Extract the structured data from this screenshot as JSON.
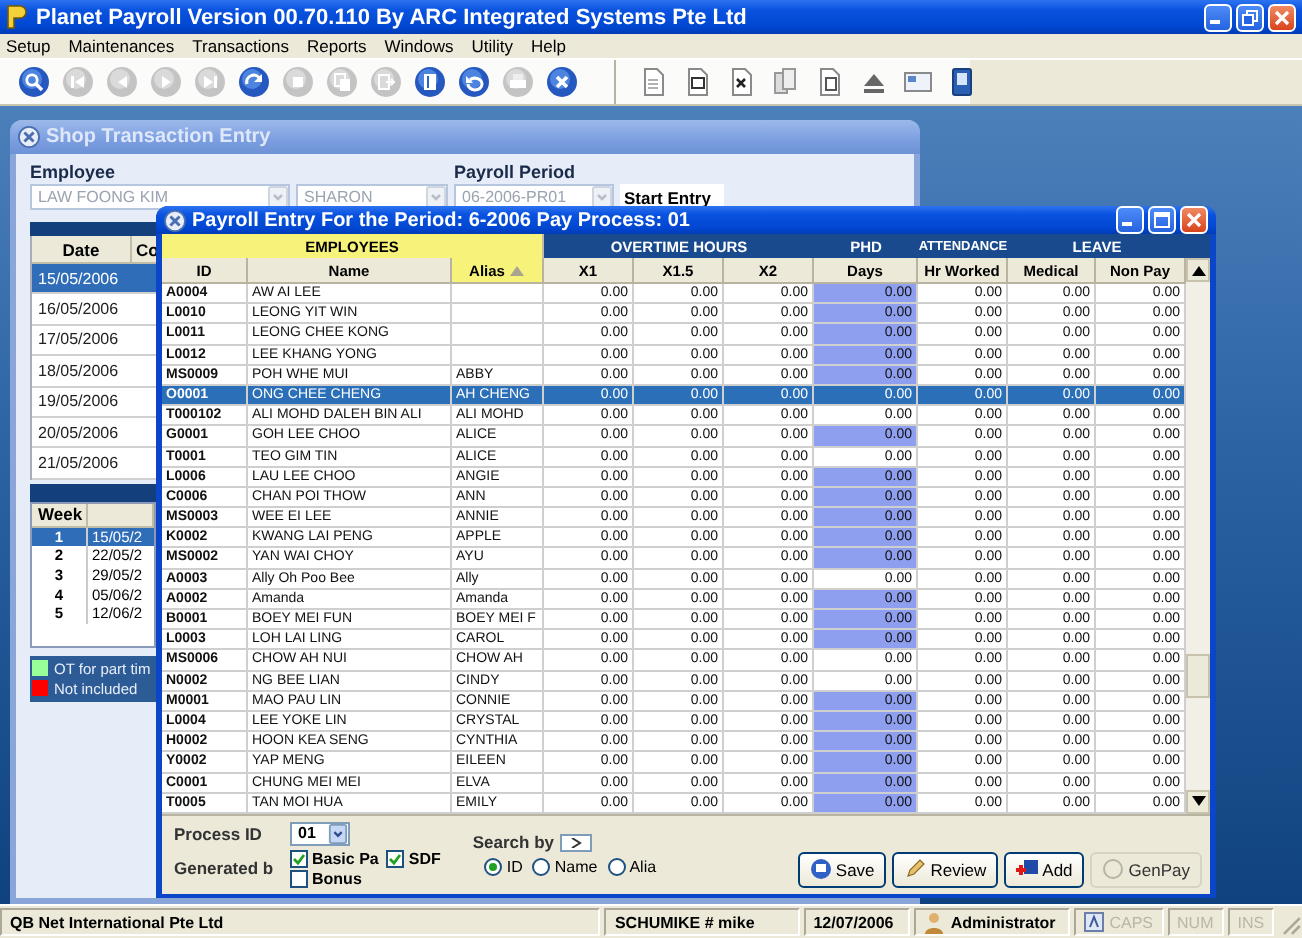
{
  "window": {
    "title": "Planet Payroll Version 00.70.110 By ARC Integrated Systems Pte Ltd"
  },
  "menu": [
    "Setup",
    "Maintenances",
    "Transactions",
    "Reports",
    "Windows",
    "Utility",
    "Help"
  ],
  "toolbar": {
    "navigation": [
      {
        "kind": "search",
        "disabled": false
      },
      {
        "kind": "first",
        "disabled": true
      },
      {
        "kind": "prev",
        "disabled": true
      },
      {
        "kind": "next",
        "disabled": true
      },
      {
        "kind": "last",
        "disabled": true
      },
      {
        "kind": "refresh",
        "disabled": false
      },
      {
        "kind": "stop",
        "disabled": true
      },
      {
        "kind": "copy",
        "disabled": true
      },
      {
        "kind": "export",
        "disabled": true
      },
      {
        "kind": "book",
        "disabled": false
      },
      {
        "kind": "undo",
        "disabled": false
      },
      {
        "kind": "print",
        "disabled": true
      },
      {
        "kind": "close",
        "disabled": false
      }
    ],
    "documents": [
      {
        "kind": "page"
      },
      {
        "kind": "word"
      },
      {
        "kind": "excel"
      },
      {
        "kind": "pages"
      },
      {
        "kind": "paste"
      },
      {
        "kind": "eject"
      },
      {
        "kind": "card"
      },
      {
        "kind": "phone"
      }
    ]
  },
  "shop_window": {
    "title": "Shop Transaction Entry",
    "employee_label": "Employee",
    "payroll_period_label": "Payroll Period",
    "employee_fields": [
      {
        "value": "LAW FOONG KIM",
        "disabled": true
      },
      {
        "value": "SHARON",
        "disabled": true
      }
    ],
    "period_field": {
      "value": "06-2006-PR01",
      "disabled": true
    },
    "start_button": "Start Entry",
    "date_columns": [
      "Date",
      "Co"
    ],
    "dates": [
      {
        "date": "15/05/2006",
        "selected": true
      },
      {
        "date": "16/05/2006",
        "selected": false
      },
      {
        "date": "17/05/2006",
        "selected": false
      },
      {
        "date": "18/05/2006",
        "selected": false
      },
      {
        "date": "19/05/2006",
        "selected": false
      },
      {
        "date": "20/05/2006",
        "selected": false
      },
      {
        "date": "21/05/2006",
        "selected": false
      }
    ],
    "week_column": "Week",
    "weeks": [
      {
        "week": "1",
        "date": "15/05/2",
        "selected": true
      },
      {
        "week": "2",
        "date": "22/05/2",
        "selected": false
      },
      {
        "week": "3",
        "date": "29/05/2",
        "selected": false
      },
      {
        "week": "4",
        "date": "05/06/2",
        "selected": false
      },
      {
        "week": "5",
        "date": "12/06/2",
        "selected": false
      }
    ],
    "legend": [
      {
        "label": "OT for part tim",
        "color": "#99ff99"
      },
      {
        "label": "Not included",
        "color": "#ff0000"
      }
    ]
  },
  "payroll_window": {
    "title": "Payroll Entry For the Period: 6-2006 Pay Process: 01",
    "groups": [
      {
        "label": "EMPLOYEES",
        "highlighted": true,
        "columns": [
          {
            "label": "ID",
            "highlighted": false,
            "sorted": false
          },
          {
            "label": "Name",
            "highlighted": false,
            "sorted": false
          },
          {
            "label": "Alias",
            "highlighted": true,
            "sorted": true
          }
        ]
      },
      {
        "label": "OVERTIME HOURS",
        "highlighted": false,
        "columns": [
          {
            "label": "X1",
            "highlighted": false,
            "sorted": false
          },
          {
            "label": "X1.5",
            "highlighted": false,
            "sorted": false
          },
          {
            "label": "X2",
            "highlighted": false,
            "sorted": false
          }
        ]
      },
      {
        "label": "PHD",
        "highlighted": false,
        "columns": [
          {
            "label": "Days",
            "highlighted": false,
            "sorted": false
          }
        ]
      },
      {
        "label": "ATTENDANCE",
        "highlighted": false,
        "columns": [
          {
            "label": "Hr Worked",
            "highlighted": false,
            "sorted": false
          }
        ]
      },
      {
        "label": "LEAVE",
        "highlighted": false,
        "columns": [
          {
            "label": "Medical",
            "highlighted": false,
            "sorted": false
          },
          {
            "label": "Non Pay",
            "highlighted": false,
            "sorted": false
          }
        ]
      }
    ],
    "rows": [
      {
        "id": "A0004",
        "name": "AW AI LEE",
        "values": [
          "0.00",
          "0.00",
          "0.00",
          "0.00",
          "0.00",
          "0.00",
          "0.00"
        ],
        "days_marked": true,
        "selected": false
      },
      {
        "id": "L0010",
        "name": "LEONG YIT WIN",
        "values": [
          "0.00",
          "0.00",
          "0.00",
          "0.00",
          "0.00",
          "0.00",
          "0.00"
        ],
        "days_marked": true,
        "selected": false
      },
      {
        "id": "L0011",
        "name": "LEONG CHEE KONG",
        "values": [
          "0.00",
          "0.00",
          "0.00",
          "0.00",
          "0.00",
          "0.00",
          "0.00"
        ],
        "days_marked": true,
        "selected": false
      },
      {
        "id": "L0012",
        "name": "LEE KHANG YONG",
        "values": [
          "0.00",
          "0.00",
          "0.00",
          "0.00",
          "0.00",
          "0.00",
          "0.00"
        ],
        "days_marked": true,
        "selected": false
      },
      {
        "id": "MS0009",
        "name": "POH WHE MUI",
        "alias": "ABBY",
        "values": [
          "0.00",
          "0.00",
          "0.00",
          "0.00",
          "0.00",
          "0.00",
          "0.00"
        ],
        "days_marked": true,
        "selected": false
      },
      {
        "id": "O0001",
        "name": "ONG CHEE CHENG",
        "alias": "AH CHENG",
        "values": [
          "0.00",
          "0.00",
          "0.00",
          "0.00",
          "0.00",
          "0.00",
          "0.00"
        ],
        "days_marked": false,
        "selected": true
      },
      {
        "id": "T000102",
        "name": "ALI MOHD DALEH BIN ALI",
        "alias": "ALI MOHD",
        "values": [
          "0.00",
          "0.00",
          "0.00",
          "0.00",
          "0.00",
          "0.00",
          "0.00"
        ],
        "days_marked": false,
        "selected": false
      },
      {
        "id": "G0001",
        "name": "GOH LEE CHOO",
        "alias": "ALICE",
        "values": [
          "0.00",
          "0.00",
          "0.00",
          "0.00",
          "0.00",
          "0.00",
          "0.00"
        ],
        "days_marked": true,
        "selected": false
      },
      {
        "id": "T0001",
        "name": "TEO GIM TIN",
        "alias": "ALICE",
        "values": [
          "0.00",
          "0.00",
          "0.00",
          "0.00",
          "0.00",
          "0.00",
          "0.00"
        ],
        "days_marked": false,
        "selected": false
      },
      {
        "id": "L0006",
        "name": "LAU LEE CHOO",
        "alias": "ANGIE",
        "values": [
          "0.00",
          "0.00",
          "0.00",
          "0.00",
          "0.00",
          "0.00",
          "0.00"
        ],
        "days_marked": true,
        "selected": false
      },
      {
        "id": "C0006",
        "name": "CHAN POI THOW",
        "alias": "ANN",
        "values": [
          "0.00",
          "0.00",
          "0.00",
          "0.00",
          "0.00",
          "0.00",
          "0.00"
        ],
        "days_marked": true,
        "selected": false
      },
      {
        "id": "MS0003",
        "name": "WEE EI LEE",
        "alias": "ANNIE",
        "values": [
          "0.00",
          "0.00",
          "0.00",
          "0.00",
          "0.00",
          "0.00",
          "0.00"
        ],
        "days_marked": true,
        "selected": false
      },
      {
        "id": "K0002",
        "name": "KWANG LAI PENG",
        "alias": "APPLE",
        "values": [
          "0.00",
          "0.00",
          "0.00",
          "0.00",
          "0.00",
          "0.00",
          "0.00"
        ],
        "days_marked": true,
        "selected": false
      },
      {
        "id": "MS0002",
        "name": "YAN WAI CHOY",
        "alias": "AYU",
        "values": [
          "0.00",
          "0.00",
          "0.00",
          "0.00",
          "0.00",
          "0.00",
          "0.00"
        ],
        "days_marked": true,
        "selected": false
      },
      {
        "id": "A0003",
        "name": "Ally Oh Poo Bee",
        "alias": "Ally",
        "values": [
          "0.00",
          "0.00",
          "0.00",
          "0.00",
          "0.00",
          "0.00",
          "0.00"
        ],
        "days_marked": false,
        "selected": false
      },
      {
        "id": "A0002",
        "name": "Amanda",
        "alias": "Amanda",
        "values": [
          "0.00",
          "0.00",
          "0.00",
          "0.00",
          "0.00",
          "0.00",
          "0.00"
        ],
        "days_marked": true,
        "selected": false
      },
      {
        "id": "B0001",
        "name": "BOEY MEI FUN",
        "alias": "BOEY MEI F",
        "values": [
          "0.00",
          "0.00",
          "0.00",
          "0.00",
          "0.00",
          "0.00",
          "0.00"
        ],
        "days_marked": true,
        "selected": false
      },
      {
        "id": "L0003",
        "name": "LOH LAI LING",
        "alias": "CAROL",
        "values": [
          "0.00",
          "0.00",
          "0.00",
          "0.00",
          "0.00",
          "0.00",
          "0.00"
        ],
        "days_marked": true,
        "selected": false
      },
      {
        "id": "MS0006",
        "name": "CHOW AH NUI",
        "alias": "CHOW AH",
        "values": [
          "0.00",
          "0.00",
          "0.00",
          "0.00",
          "0.00",
          "0.00",
          "0.00"
        ],
        "days_marked": false,
        "selected": false
      },
      {
        "id": "N0002",
        "name": "NG BEE LIAN",
        "alias": "CINDY",
        "values": [
          "0.00",
          "0.00",
          "0.00",
          "0.00",
          "0.00",
          "0.00",
          "0.00"
        ],
        "days_marked": false,
        "selected": false
      },
      {
        "id": "M0001",
        "name": "MAO PAU LIN",
        "alias": "CONNIE",
        "values": [
          "0.00",
          "0.00",
          "0.00",
          "0.00",
          "0.00",
          "0.00",
          "0.00"
        ],
        "days_marked": true,
        "selected": false
      },
      {
        "id": "L0004",
        "name": "LEE YOKE LIN",
        "alias": "CRYSTAL",
        "values": [
          "0.00",
          "0.00",
          "0.00",
          "0.00",
          "0.00",
          "0.00",
          "0.00"
        ],
        "days_marked": true,
        "selected": false
      },
      {
        "id": "H0002",
        "name": "HOON KEA SENG",
        "alias": "CYNTHIA",
        "values": [
          "0.00",
          "0.00",
          "0.00",
          "0.00",
          "0.00",
          "0.00",
          "0.00"
        ],
        "days_marked": true,
        "selected": false
      },
      {
        "id": "Y0002",
        "name": "YAP MENG",
        "alias": "EILEEN",
        "values": [
          "0.00",
          "0.00",
          "0.00",
          "0.00",
          "0.00",
          "0.00",
          "0.00"
        ],
        "days_marked": true,
        "selected": false
      },
      {
        "id": "C0001",
        "name": "CHUNG MEI MEI",
        "alias": "ELVA",
        "values": [
          "0.00",
          "0.00",
          "0.00",
          "0.00",
          "0.00",
          "0.00",
          "0.00"
        ],
        "days_marked": true,
        "selected": false
      },
      {
        "id": "T0005",
        "name": "TAN MOI HUA",
        "alias": "EMILY",
        "values": [
          "0.00",
          "0.00",
          "0.00",
          "0.00",
          "0.00",
          "0.00",
          "0.00"
        ],
        "days_marked": true,
        "selected": false
      }
    ],
    "process_id": {
      "label": "Process ID",
      "value": "01"
    },
    "generated_by": {
      "label": "Generated b",
      "options": [
        {
          "label": "Basic Pa",
          "checked": true
        },
        {
          "label": "SDF",
          "checked": true
        },
        {
          "label": "Bonus",
          "checked": false
        }
      ]
    },
    "search_by": {
      "label": "Search by",
      "options": [
        {
          "label": "ID",
          "selected": true
        },
        {
          "label": "Name",
          "selected": false
        },
        {
          "label": "Alia",
          "selected": false
        }
      ]
    },
    "buttons": [
      {
        "label": "Save",
        "kind": "save"
      },
      {
        "label": "Review",
        "kind": "review"
      },
      {
        "label": "Add",
        "kind": "add"
      },
      {
        "label": "GenPay",
        "kind": "genpay"
      }
    ]
  },
  "status_bar": {
    "company": "QB Net International Pte Ltd",
    "user": "SCHUMIKE # mike",
    "date": "12/07/2006",
    "role": "Administrator",
    "indicators": [
      {
        "label": "CAPS",
        "on": false
      },
      {
        "label": "NUM",
        "on": false
      },
      {
        "label": "INS",
        "on": false
      }
    ]
  }
}
